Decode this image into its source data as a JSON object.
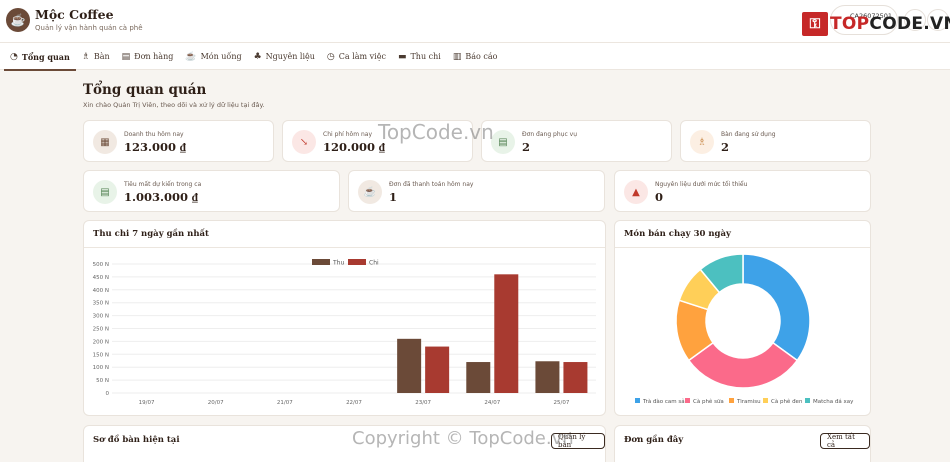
{
  "header": {
    "app_title": "Mộc Coffee",
    "app_subtitle": "Quản lý vận hành quán cà phê",
    "user_code": "CA26072501",
    "watermark_logo": "TOPCODE.VN"
  },
  "nav": [
    {
      "label": "Tổng quan",
      "icon": "dashboard-icon",
      "active": true
    },
    {
      "label": "Bàn",
      "icon": "chair-icon"
    },
    {
      "label": "Đơn hàng",
      "icon": "receipt-icon"
    },
    {
      "label": "Món uống",
      "icon": "cup-icon"
    },
    {
      "label": "Nguyên liệu",
      "icon": "ingredients-icon"
    },
    {
      "label": "Ca làm việc",
      "icon": "clock-icon"
    },
    {
      "label": "Thu chi",
      "icon": "wallet-icon"
    },
    {
      "label": "Báo cáo",
      "icon": "report-icon"
    }
  ],
  "page": {
    "title": "Tổng quan quán",
    "subtitle": "Xin chào Quản Trị Viên, theo dõi và xử lý dữ liệu tại đây."
  },
  "stats_row1": [
    {
      "label": "Doanh thu hôm nay",
      "value": "123.000 ₫",
      "icon": "money-icon",
      "color": "#f1e9e2",
      "fg": "#6b4a38"
    },
    {
      "label": "Chi phí hôm nay",
      "value": "120.000 ₫",
      "icon": "trend-down-icon",
      "color": "#fbe7e5",
      "fg": "#c0392b"
    },
    {
      "label": "Đơn đang phục vụ",
      "value": "2",
      "icon": "receipt-icon",
      "color": "#e8f3e8",
      "fg": "#4f7f4f"
    },
    {
      "label": "Bàn đang sử dụng",
      "value": "2",
      "icon": "chair-icon",
      "color": "#fcefe3",
      "fg": "#c98a4a"
    }
  ],
  "stats_row2": [
    {
      "label": "Tiêu mất dự kiến trong ca",
      "value": "1.003.000 ₫",
      "icon": "cash-icon",
      "color": "#e8f3e8",
      "fg": "#4f7f4f"
    },
    {
      "label": "Đơn đã thanh toán hôm nay",
      "value": "1",
      "icon": "cup-icon",
      "color": "#f1e9e2",
      "fg": "#6b4a38"
    },
    {
      "label": "Nguyên liệu dưới mức tối thiểu",
      "value": "0",
      "icon": "warning-icon",
      "color": "#fbe7e5",
      "fg": "#c0392b"
    }
  ],
  "panels": {
    "income_title": "Thu chi 7 ngày gần nhất",
    "top_items_title": "Món bán chạy 30 ngày",
    "table_map_title": "Sơ đồ bàn hiện tại",
    "recent_orders_title": "Đơn gần đây",
    "view_all_label": "Xem tất cả",
    "table_btn_label": "Quản lý bàn"
  },
  "watermarks": {
    "center": "TopCode.vn",
    "bottom": "Copyright © TopCode.vn"
  },
  "chart_data": [
    {
      "type": "bar",
      "categories": [
        "19/07",
        "20/07",
        "21/07",
        "22/07",
        "23/07",
        "24/07",
        "25/07"
      ],
      "series": [
        {
          "name": "Thu",
          "color": "#6b4a38",
          "values": [
            0,
            0,
            0,
            0,
            210,
            120,
            123
          ]
        },
        {
          "name": "Chi",
          "color": "#a83a30",
          "values": [
            0,
            0,
            0,
            0,
            180,
            460,
            120
          ]
        }
      ],
      "ylim": [
        0,
        500
      ],
      "yticks": [
        "0",
        "50 N",
        "100 N",
        "150 N",
        "200 N",
        "250 N",
        "300 N",
        "350 N",
        "400 N",
        "450 N",
        "500 N"
      ],
      "legend": "top"
    },
    {
      "type": "pie",
      "donut": true,
      "categories": [
        "Trà đào cam sả",
        "Cà phê sữa",
        "Tiramisu",
        "Cà phê đen",
        "Matcha đá xay"
      ],
      "values": [
        35,
        30,
        15,
        9,
        11
      ],
      "colors": [
        "#3ea2e8",
        "#fb6a8a",
        "#ffa23e",
        "#ffcf58",
        "#4cc0c0"
      ],
      "legend": "bottom"
    }
  ]
}
